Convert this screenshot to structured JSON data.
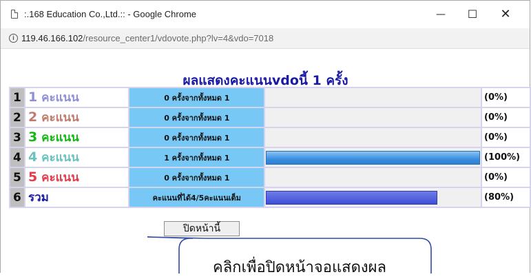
{
  "window": {
    "title": ":.168 Education Co.,Ltd.:: - Google Chrome",
    "min_glyph": "—",
    "max_glyph": "☐",
    "close_glyph": "✕"
  },
  "address": {
    "host": "119.46.166.102",
    "path": "/resource_center1/vdovote.php?lv=4&vdo=7018"
  },
  "heading": "ผลแสดงคะแนนvdoนี้ 1 ครั้ง",
  "rows": [
    {
      "rank": "1",
      "score": "1",
      "unit": "คะแนน",
      "color": "#8f8fd8",
      "votes": "0 ครั้งจากทั้งหมด 1",
      "fraction": 0,
      "pct": "(0%)"
    },
    {
      "rank": "2",
      "score": "2",
      "unit": "คะแนน",
      "color": "#c07b6e",
      "votes": "0 ครั้งจากทั้งหมด 1",
      "fraction": 0,
      "pct": "(0%)"
    },
    {
      "rank": "3",
      "score": "3",
      "unit": "คะแนน",
      "color": "#14b814",
      "votes": "0 ครั้งจากทั้งหมด 1",
      "fraction": 0,
      "pct": "(0%)"
    },
    {
      "rank": "4",
      "score": "4",
      "unit": "คะแนน",
      "color": "#6ac2bd",
      "votes": "1 ครั้งจากทั้งหมด 1",
      "fraction": 1.0,
      "pct": "(100%)"
    },
    {
      "rank": "5",
      "score": "5",
      "unit": "คะแนน",
      "color": "#e83a4a",
      "votes": "0 ครั้งจากทั้งหมด 1",
      "fraction": 0,
      "pct": "(0%)"
    }
  ],
  "total": {
    "rank": "6",
    "label": "รวม",
    "color": "#1a1aa6",
    "text": "คะแนนที่ได้4/5คะแนนเต็ม",
    "fraction": 0.8,
    "pct": "(80%)"
  },
  "close_button": "ปิดหน้านี้",
  "callout": "คลิกเพื่อปิดหน้าจอแสดงผล"
}
